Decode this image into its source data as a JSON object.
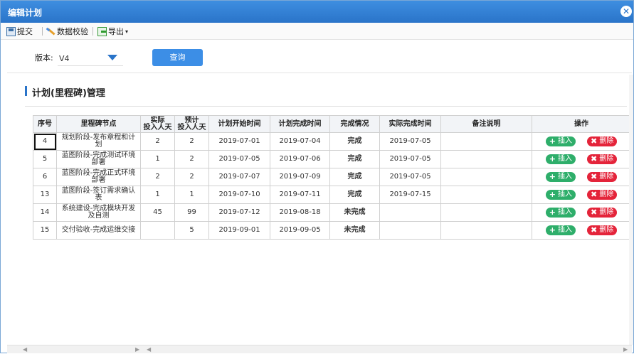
{
  "window": {
    "title": "编辑计划"
  },
  "toolbar": {
    "submit_label": "提交",
    "validate_label": "数据校验",
    "export_label": "导出",
    "export_caret": "▾"
  },
  "filter": {
    "version_label": "版本:",
    "version_value": "V4",
    "query_label": "查询"
  },
  "section": {
    "title": "计划(里程碑)管理"
  },
  "table": {
    "headers": {
      "seq": "序号",
      "node": "里程碑节点",
      "actual_input_line1": "实际",
      "actual_input_line2": "投入人天",
      "planned_input_line1": "预计",
      "planned_input_line2": "投入人天",
      "plan_start": "计划开始时间",
      "plan_end": "计划完成时间",
      "status": "完成情况",
      "actual_end": "实际完成时间",
      "remark": "备注说明",
      "ops": "操作"
    },
    "rows": [
      {
        "seq": "4",
        "node": "规划阶段-发布章程和计划",
        "actual": "2",
        "planned": "2",
        "start": "2019-07-01",
        "end": "2019-07-04",
        "status": "完成",
        "actual_end": "2019-07-05",
        "remark": ""
      },
      {
        "seq": "5",
        "node": "蓝图阶段-完成测试环境部署",
        "actual": "1",
        "planned": "2",
        "start": "2019-07-05",
        "end": "2019-07-06",
        "status": "完成",
        "actual_end": "2019-07-05",
        "remark": ""
      },
      {
        "seq": "6",
        "node": "蓝图阶段-完成正式环境部署",
        "actual": "2",
        "planned": "2",
        "start": "2019-07-07",
        "end": "2019-07-09",
        "status": "完成",
        "actual_end": "2019-07-05",
        "remark": ""
      },
      {
        "seq": "13",
        "node": "蓝图阶段-签订需求确认表",
        "actual": "1",
        "planned": "1",
        "start": "2019-07-10",
        "end": "2019-07-11",
        "status": "完成",
        "actual_end": "2019-07-15",
        "remark": ""
      },
      {
        "seq": "14",
        "node": "系统建设-完成模块开发及自测",
        "actual": "45",
        "planned": "99",
        "start": "2019-07-12",
        "end": "2019-08-18",
        "status": "未完成",
        "actual_end": "",
        "remark": ""
      },
      {
        "seq": "15",
        "node": "交付验收-完成运维交接",
        "actual": "",
        "planned": "5",
        "start": "2019-09-01",
        "end": "2019-09-05",
        "status": "未完成",
        "actual_end": "",
        "remark": ""
      }
    ],
    "insert_label": "插入",
    "delete_label": "删除",
    "insert_glyph": "+",
    "delete_glyph": "✖"
  },
  "colors": {
    "titlebar": "#2a74c9",
    "done": "#f08c00",
    "undone": "#e21a1a",
    "insert": "#2eae6a",
    "delete": "#e4243a",
    "query": "#3c8ee6"
  }
}
